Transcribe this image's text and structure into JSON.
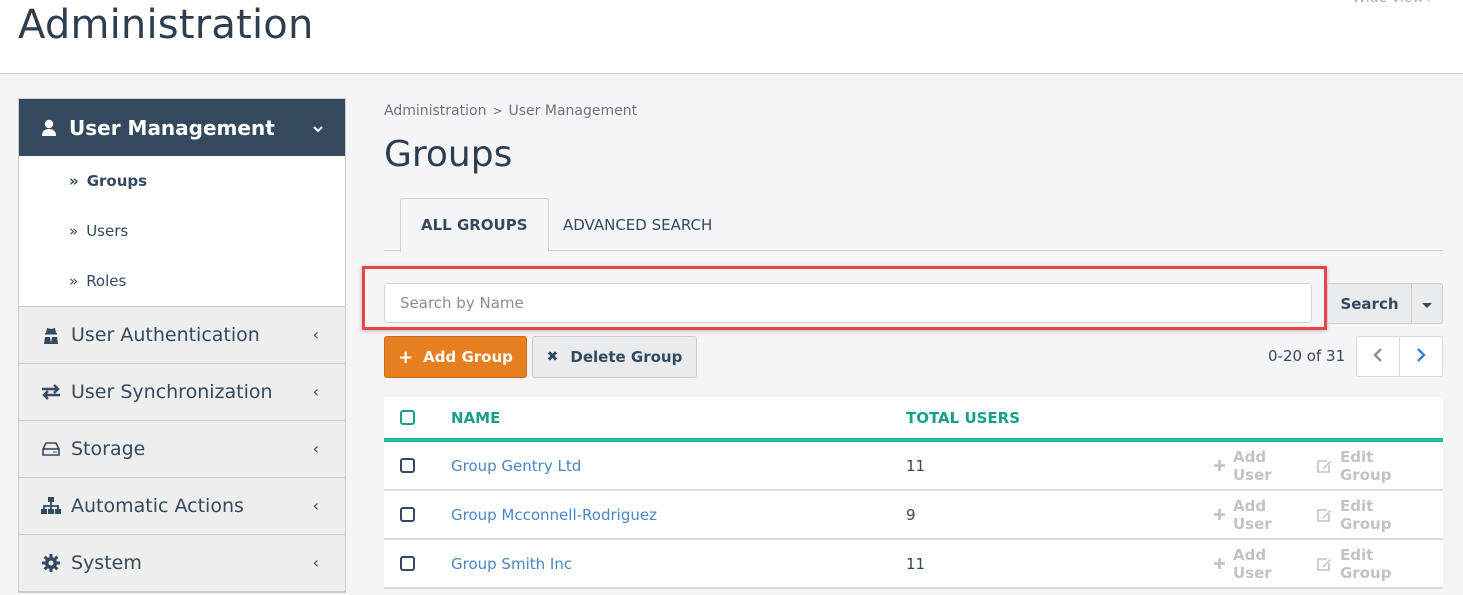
{
  "header": {
    "title": "Administration",
    "wide_view_label": "Wide view"
  },
  "sidebar": {
    "section": {
      "label": "User Management",
      "icon": "user-icon",
      "expanded": true,
      "items": [
        {
          "label": "Groups",
          "active": true
        },
        {
          "label": "Users",
          "active": false
        },
        {
          "label": "Roles",
          "active": false
        }
      ]
    },
    "items": [
      {
        "label": "User Authentication",
        "icon": "user-secret-icon"
      },
      {
        "label": "User Synchronization",
        "icon": "exchange-icon"
      },
      {
        "label": "Storage",
        "icon": "hdd-icon"
      },
      {
        "label": "Automatic Actions",
        "icon": "sitemap-icon"
      },
      {
        "label": "System",
        "icon": "gear-icon"
      }
    ]
  },
  "breadcrumb": [
    "Administration",
    "User Management"
  ],
  "page_title": "Groups",
  "tabs": [
    {
      "label": "ALL GROUPS",
      "active": true
    },
    {
      "label": "ADVANCED SEARCH",
      "active": false
    }
  ],
  "search": {
    "placeholder": "Search by Name",
    "value": "",
    "button_label": "Search"
  },
  "toolbar": {
    "add_label": "Add Group",
    "delete_label": "Delete Group"
  },
  "pagination": {
    "range_text": "0-20 of 31"
  },
  "table": {
    "columns": [
      "NAME",
      "TOTAL USERS"
    ],
    "rows": [
      {
        "name": "Group Gentry Ltd",
        "total_users": "11"
      },
      {
        "name": "Group Mcconnell-Rodriguez",
        "total_users": "9"
      },
      {
        "name": "Group Smith Inc",
        "total_users": "11"
      }
    ],
    "row_actions": [
      "Add User",
      "Edit Group"
    ]
  },
  "colors": {
    "sidebar_header": "#34495e",
    "accent_teal": "#1abc9c",
    "add_button": "#e67e22",
    "link": "#4a86c5",
    "highlight_box": "#e8454a"
  }
}
